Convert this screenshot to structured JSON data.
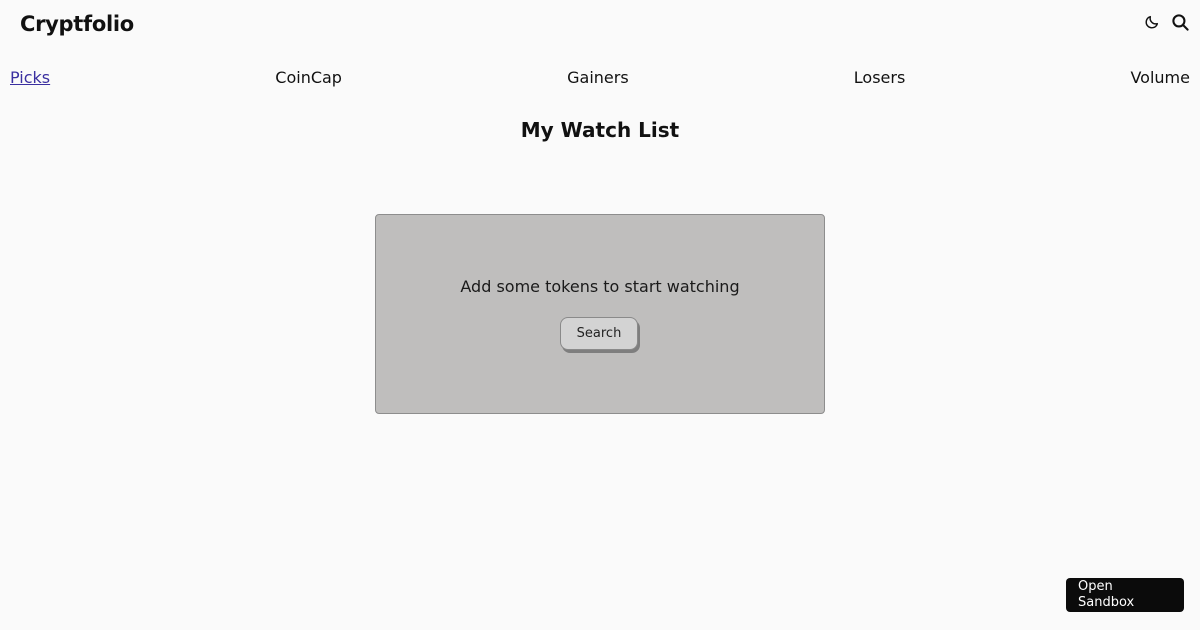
{
  "app": {
    "brand": "Cryptfolio"
  },
  "header": {
    "actions": [
      {
        "icon": "moon-icon"
      },
      {
        "icon": "search-icon"
      }
    ]
  },
  "nav": {
    "items": [
      {
        "label": "Picks",
        "active": true
      },
      {
        "label": "CoinCap",
        "active": false
      },
      {
        "label": "Gainers",
        "active": false
      },
      {
        "label": "Losers",
        "active": false
      },
      {
        "label": "Volume",
        "active": false
      }
    ]
  },
  "main": {
    "title": "My Watch List",
    "empty_state": {
      "message": "Add some tokens to start watching",
      "button_label": "Search"
    }
  },
  "sandbox": {
    "label": "Open Sandbox"
  },
  "colors": {
    "active_link": "#3a2fa0",
    "card_background": "#bfbebd",
    "page_background": "#fafafa"
  }
}
